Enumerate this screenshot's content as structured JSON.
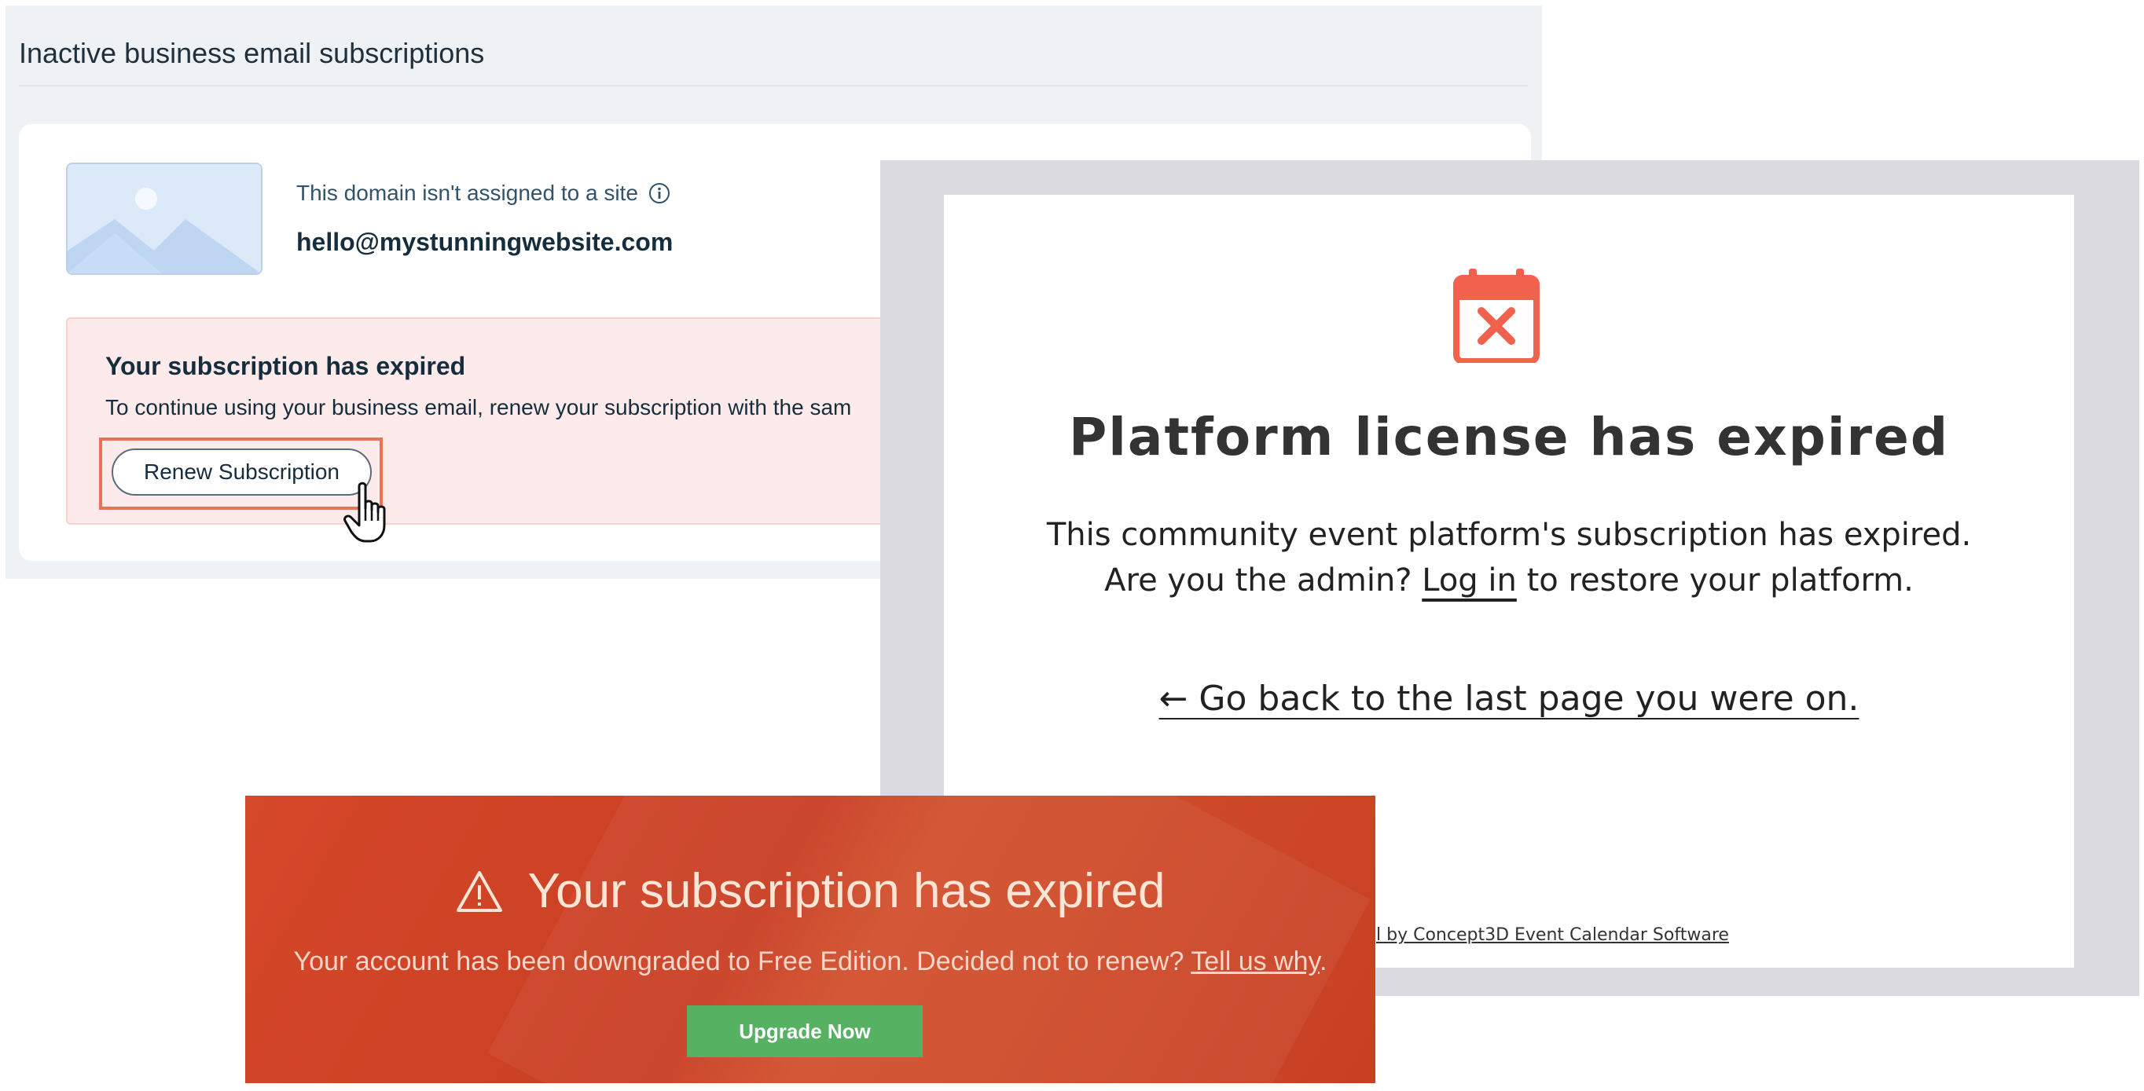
{
  "wix_panel": {
    "title": "Inactive business email subscriptions",
    "domain_status": "This domain isn't assigned to a site",
    "email": "hello@mystunningwebsite.com",
    "alert": {
      "title": "Your subscription has expired",
      "text": "To continue using your business email, renew your subscription with the sam",
      "button_label": "Renew Subscription"
    },
    "colors": {
      "alert_bg": "#fdeaea",
      "highlight": "#e8735a"
    },
    "icons": [
      "image-placeholder-icon",
      "info-icon",
      "hand-pointer-icon"
    ]
  },
  "license_panel": {
    "title": "Platform license has expired",
    "line1": "This community event platform's subscription has expired.",
    "line2_prefix": "Are you the admin?",
    "line2_link": "Log in",
    "line2_suffix": "to restore your platform.",
    "go_back": "← Go back to the last page you were on.",
    "powered_by": "l by Concept3D Event Calendar Software",
    "colors": {
      "icon": "#f0624d"
    },
    "icons": [
      "calendar-x-icon"
    ]
  },
  "banner_panel": {
    "title": "Your subscription has expired",
    "text_prefix": "Your account has been downgraded to Free Edition. Decided not to renew?",
    "text_link": "Tell us why",
    "text_suffix": ".",
    "button_label": "Upgrade Now",
    "colors": {
      "background": "#cd4326",
      "button": "#57b163"
    },
    "icons": [
      "warning-triangle-icon"
    ]
  }
}
